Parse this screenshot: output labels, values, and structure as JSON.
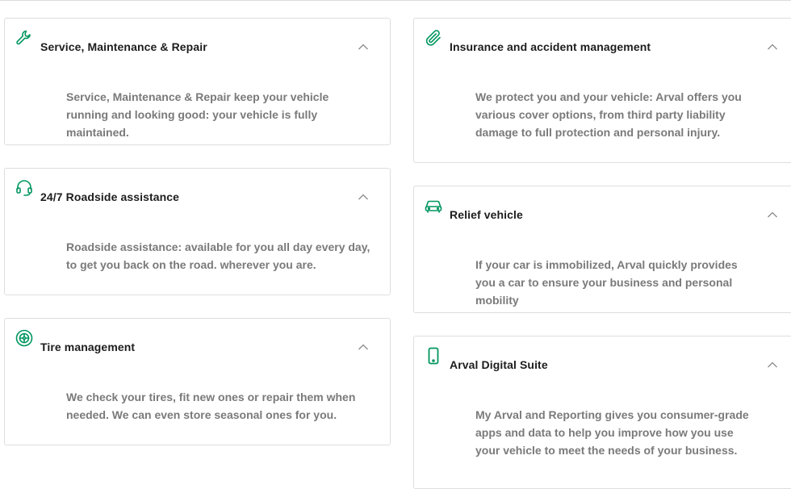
{
  "colors": {
    "accent": "#00965e",
    "title": "#1d1d1d",
    "body": "#7a7a7a",
    "border": "#dedede"
  },
  "cards": [
    {
      "icon": "wrench-icon",
      "title": "Service, Maintenance & Repair",
      "description": "Service, Maintenance & Repair keep your vehicle running and looking good: your vehicle is fully maintained."
    },
    {
      "icon": "headset-icon",
      "title": "24/7 Roadside assistance",
      "description": "Roadside assistance: available for you all day every day, to get you back on the road. wherever you are."
    },
    {
      "icon": "tire-icon",
      "title": "Tire management",
      "description": "We check your tires, fit new ones or repair them when needed. We can even store seasonal ones for you."
    },
    {
      "icon": "paperclip-icon",
      "title": "Insurance and accident management",
      "description": "We protect you and your vehicle: Arval offers you various cover options, from third party liability damage to full protection and personal injury."
    },
    {
      "icon": "car-icon",
      "title": "Relief vehicle",
      "description": "If your car is immobilized, Arval quickly provides you a car to ensure your business and personal mobility"
    },
    {
      "icon": "smartphone-icon",
      "title": "Arval Digital Suite",
      "description": "My Arval and Reporting gives you consumer-grade apps and data to help you improve how you use your vehicle to meet the needs of your business."
    }
  ]
}
